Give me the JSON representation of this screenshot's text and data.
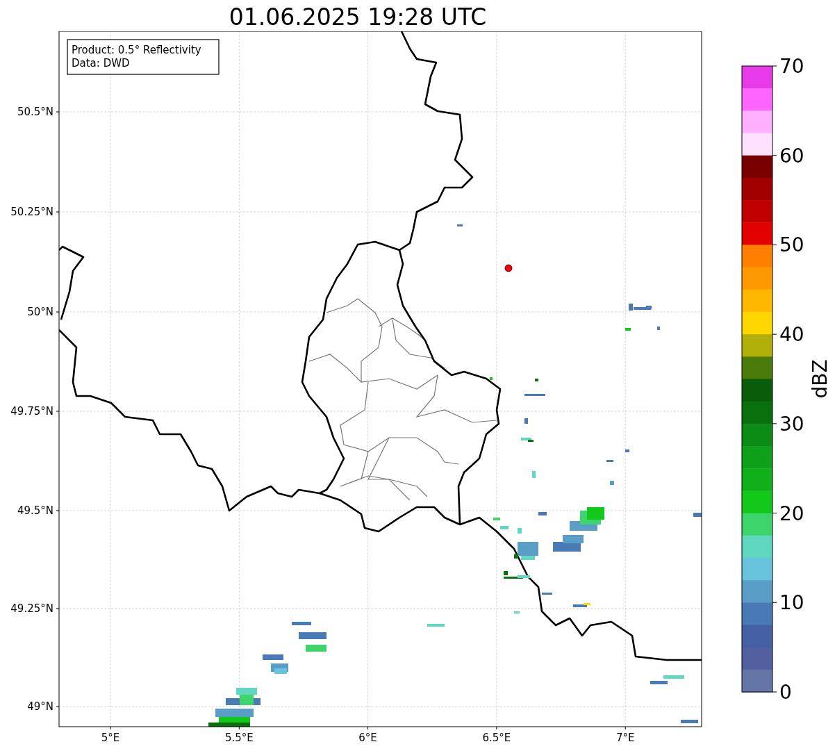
{
  "title": "01.06.2025 19:28 UTC",
  "map": {
    "info_box": [
      "Product: 0.5° Reflectivity",
      "Data: DWD"
    ],
    "lat_labels": [
      "50.5°N",
      "50.25°N",
      "50°N",
      "49.75°N",
      "49.5°N",
      "49.25°N",
      "49°N"
    ],
    "lon_labels": [
      "5°E",
      "5.5°E",
      "6°E",
      "6.5°E",
      "7°E"
    ]
  },
  "colorbar": {
    "label": "dBZ",
    "ticks": [
      "70",
      "60",
      "50",
      "40",
      "30",
      "20",
      "10",
      "0"
    ],
    "bins": [
      {
        "color": "#e83ae8"
      },
      {
        "color": "#ff66ff"
      },
      {
        "color": "#ffb0ff"
      },
      {
        "color": "#ffe0ff"
      },
      {
        "color": "#780000"
      },
      {
        "color": "#a00000"
      },
      {
        "color": "#c00000"
      },
      {
        "color": "#e30000"
      },
      {
        "color": "#ff7f00"
      },
      {
        "color": "#ff9900"
      },
      {
        "color": "#ffb700"
      },
      {
        "color": "#ffd700"
      },
      {
        "color": "#b0b008"
      },
      {
        "color": "#4a7a0a"
      },
      {
        "color": "#085c0a"
      },
      {
        "color": "#0a700e"
      },
      {
        "color": "#0c8c16"
      },
      {
        "color": "#0ea01a"
      },
      {
        "color": "#10b01a"
      },
      {
        "color": "#12c81a"
      },
      {
        "color": "#3dd46c"
      },
      {
        "color": "#60d8c0"
      },
      {
        "color": "#68c4dc"
      },
      {
        "color": "#5a9ec8"
      },
      {
        "color": "#4a7ab5"
      },
      {
        "color": "#4660a5"
      },
      {
        "color": "#525fa0"
      },
      {
        "color": "#6475a8"
      }
    ]
  }
}
